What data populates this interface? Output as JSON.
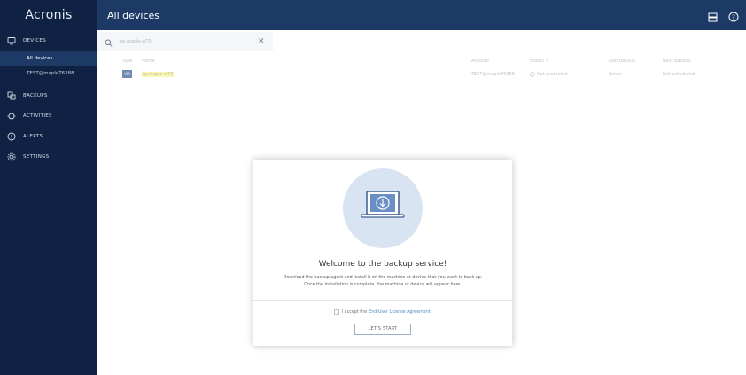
{
  "app": {
    "logo": "Acronis",
    "page_title": "All devices"
  },
  "sidebar": {
    "items": [
      {
        "label": "DEVICES",
        "icon": "monitor-icon"
      },
      {
        "label": "BACKUPS",
        "icon": "backup-icon"
      },
      {
        "label": "ACTIVITIES",
        "icon": "activities-icon"
      },
      {
        "label": "ALERTS",
        "icon": "alert-icon"
      },
      {
        "label": "SETTINGS",
        "icon": "gear-icon"
      }
    ],
    "sub_items": [
      {
        "label": "All devices",
        "active": true
      },
      {
        "label": "TEST@mapleT6388",
        "active": false
      }
    ]
  },
  "topbar": {
    "icons": [
      "grid-icon",
      "help-icon"
    ]
  },
  "search": {
    "value": "ap.maple-wT0"
  },
  "table": {
    "headers": [
      "Type",
      "Name",
      "Account",
      "Status ↑",
      "Last backup",
      "Next backup"
    ],
    "rows": [
      {
        "type": "VM",
        "name": "ap.maple-wT0",
        "account": "TEST@mapleT6388",
        "status": "Not protected",
        "last_backup": "Never",
        "next_backup": "Not scheduled"
      }
    ]
  },
  "modal": {
    "title": "Welcome to the backup service!",
    "body_line1": "Download the backup agent and install it on the machine or device that you want to back up.",
    "body_line2": "Once the installation is complete, the machine or device will appear here.",
    "eula_text": "I accept the",
    "eula_link": "End-User License Agreement.",
    "button_label": "LET'S START"
  },
  "colors": {
    "sidebar": "#0f2243",
    "topbar": "#1d3a66",
    "accent": "#4f87c7",
    "highlight": "#f7f08a"
  }
}
